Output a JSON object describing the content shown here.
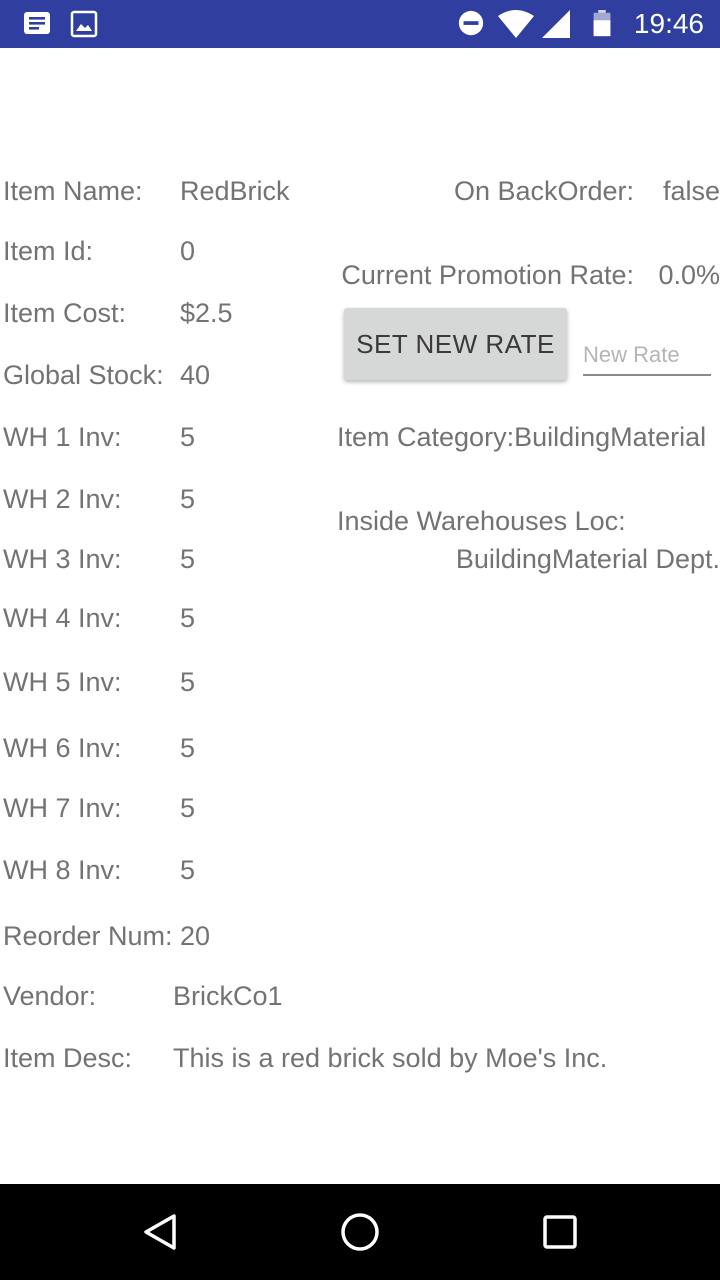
{
  "status_bar": {
    "time": "19:46",
    "color": "#303f9f",
    "icons": [
      "notification-icon",
      "image-icon",
      "do-not-disturb-icon",
      "wifi-icon",
      "signal-icon",
      "battery-icon"
    ]
  },
  "left_fields": [
    {
      "key": "item_name",
      "label": "Item Name:",
      "value": "RedBrick"
    },
    {
      "key": "item_id",
      "label": "Item Id:",
      "value": "0"
    },
    {
      "key": "item_cost",
      "label": "Item Cost:",
      "value": "$2.5"
    },
    {
      "key": "global_stock",
      "label": "Global Stock:",
      "value": "40"
    },
    {
      "key": "wh1",
      "label": "WH 1 Inv:",
      "value": "5"
    },
    {
      "key": "wh2",
      "label": "WH 2 Inv:",
      "value": "5"
    },
    {
      "key": "wh3",
      "label": "WH 3 Inv:",
      "value": "5"
    },
    {
      "key": "wh4",
      "label": "WH 4 Inv:",
      "value": "5"
    },
    {
      "key": "wh5",
      "label": "WH 5 Inv:",
      "value": "5"
    },
    {
      "key": "wh6",
      "label": "WH 6 Inv:",
      "value": "5"
    },
    {
      "key": "wh7",
      "label": "WH 7 Inv:",
      "value": "5"
    },
    {
      "key": "wh8",
      "label": "WH 8 Inv:",
      "value": "5"
    },
    {
      "key": "reorder",
      "label": "Reorder Num:",
      "value": "20"
    },
    {
      "key": "vendor",
      "label": "Vendor:",
      "value": "BrickCo1"
    },
    {
      "key": "desc",
      "label": "Item Desc:",
      "value": "This is a red brick sold by Moe's Inc."
    }
  ],
  "right_panel": {
    "backorder_label": "On BackOrder:",
    "backorder_value": "false",
    "promo_label": "Current Promotion Rate:",
    "promo_value": "0.0%",
    "set_rate_button": "SET NEW RATE",
    "new_rate_placeholder": "New Rate",
    "new_rate_value": "",
    "category_text": "Item Category:BuildingMaterial",
    "location_label": "Inside Warehouses Loc:",
    "location_value": "BuildingMaterial Dept."
  },
  "nav_bar": {
    "buttons": [
      "back-icon",
      "home-icon",
      "recents-icon"
    ]
  }
}
